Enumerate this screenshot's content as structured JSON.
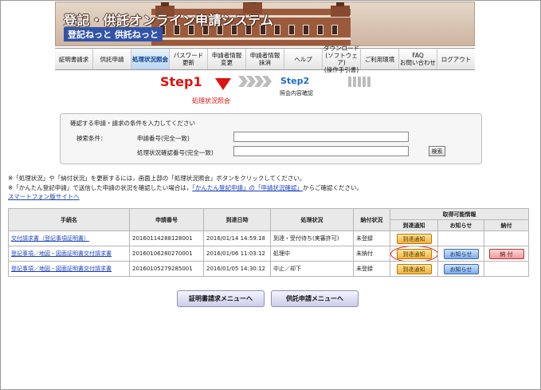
{
  "header": {
    "title": "登記・供託オンライン申請システム",
    "subtitle": "登記ねっと 供託ねっと"
  },
  "nav": {
    "items": [
      {
        "label": "証明書請求",
        "active": false
      },
      {
        "label": "供託申請",
        "active": false
      },
      {
        "label": "処理状況照会",
        "active": true
      },
      {
        "label": "パスワード\n更新",
        "active": false
      },
      {
        "label": "申請者情報\n変更",
        "active": false
      },
      {
        "label": "申請者情報\n抹消",
        "active": false
      },
      {
        "label": "ヘルプ",
        "active": false
      },
      {
        "label": "ダウンロード\n(ソフトウェア)\n(操作手引書)",
        "active": false
      },
      {
        "label": "ご利用環境",
        "active": false
      },
      {
        "label": "FAQ\nお問い合わせ",
        "active": false
      },
      {
        "label": "ログアウト",
        "active": false
      }
    ]
  },
  "steps": {
    "step1_label": "Step1",
    "step1_sub": "処理状況照会",
    "step2_label": "Step2",
    "step2_sub": "照会内容確認"
  },
  "search": {
    "heading": "確認する申請・請求の条件を入力してください",
    "condition_label": "検索条件：",
    "field1_label": "申請番号(完全一致)",
    "field1_value": "",
    "field2_label": "処理状況確認番号(完全一致)",
    "field2_value": "",
    "button_label": "検索"
  },
  "notes": {
    "note1": "※「処理状況」や「納付状況」を更新するには，画面上部の「処理状況照会」ボタンをクリックしてください。",
    "note2_prefix": "※「かんたん登記申請」で送信した申請の状況を確認したい場合は，",
    "note2_link": "「かんたん登記申請」の「申請状況確認」",
    "note2_suffix": "からご確認ください。",
    "note3_link": "スマートフォン版サイトへ"
  },
  "table": {
    "headers": {
      "procedure": "手続名",
      "application_no": "申請番号",
      "arrival_datetime": "到達日時",
      "status": "処理状況",
      "payment_status": "納付状況",
      "available_info": "取得可能情報",
      "arrival_notice": "到達通知",
      "notice": "お知らせ",
      "payment": "納付"
    },
    "rows": [
      {
        "procedure": "交付請求書（登記事項証明書）",
        "application_no": "20160114288128001",
        "arrival": "2016/01/14 14:59:18",
        "status": "到達・受付待ち(実審許可)",
        "payment": "未登録",
        "arrival_btn": "到達通知",
        "notice_btn": "",
        "pay_btn": ""
      },
      {
        "procedure": "登記事項／地図・図面証明書交付請求書",
        "application_no": "20160106280270001",
        "arrival": "2016/01/06 11:03:12",
        "status": "処理中",
        "payment": "未納付",
        "arrival_btn": "到達通知",
        "notice_btn": "お知らせ",
        "pay_btn": "納 付"
      },
      {
        "procedure": "登記事項／地図・図面証明書交付請求書",
        "application_no": "20160105279285001",
        "arrival": "2016/01/05 14:30:12",
        "status": "中止／却下",
        "payment": "未登録",
        "arrival_btn": "到達通知",
        "notice_btn": "お知らせ",
        "pay_btn": ""
      }
    ]
  },
  "bottom": {
    "cert_menu": "証明書請求メニューへ",
    "deposit_menu": "供託申請メニューへ"
  }
}
